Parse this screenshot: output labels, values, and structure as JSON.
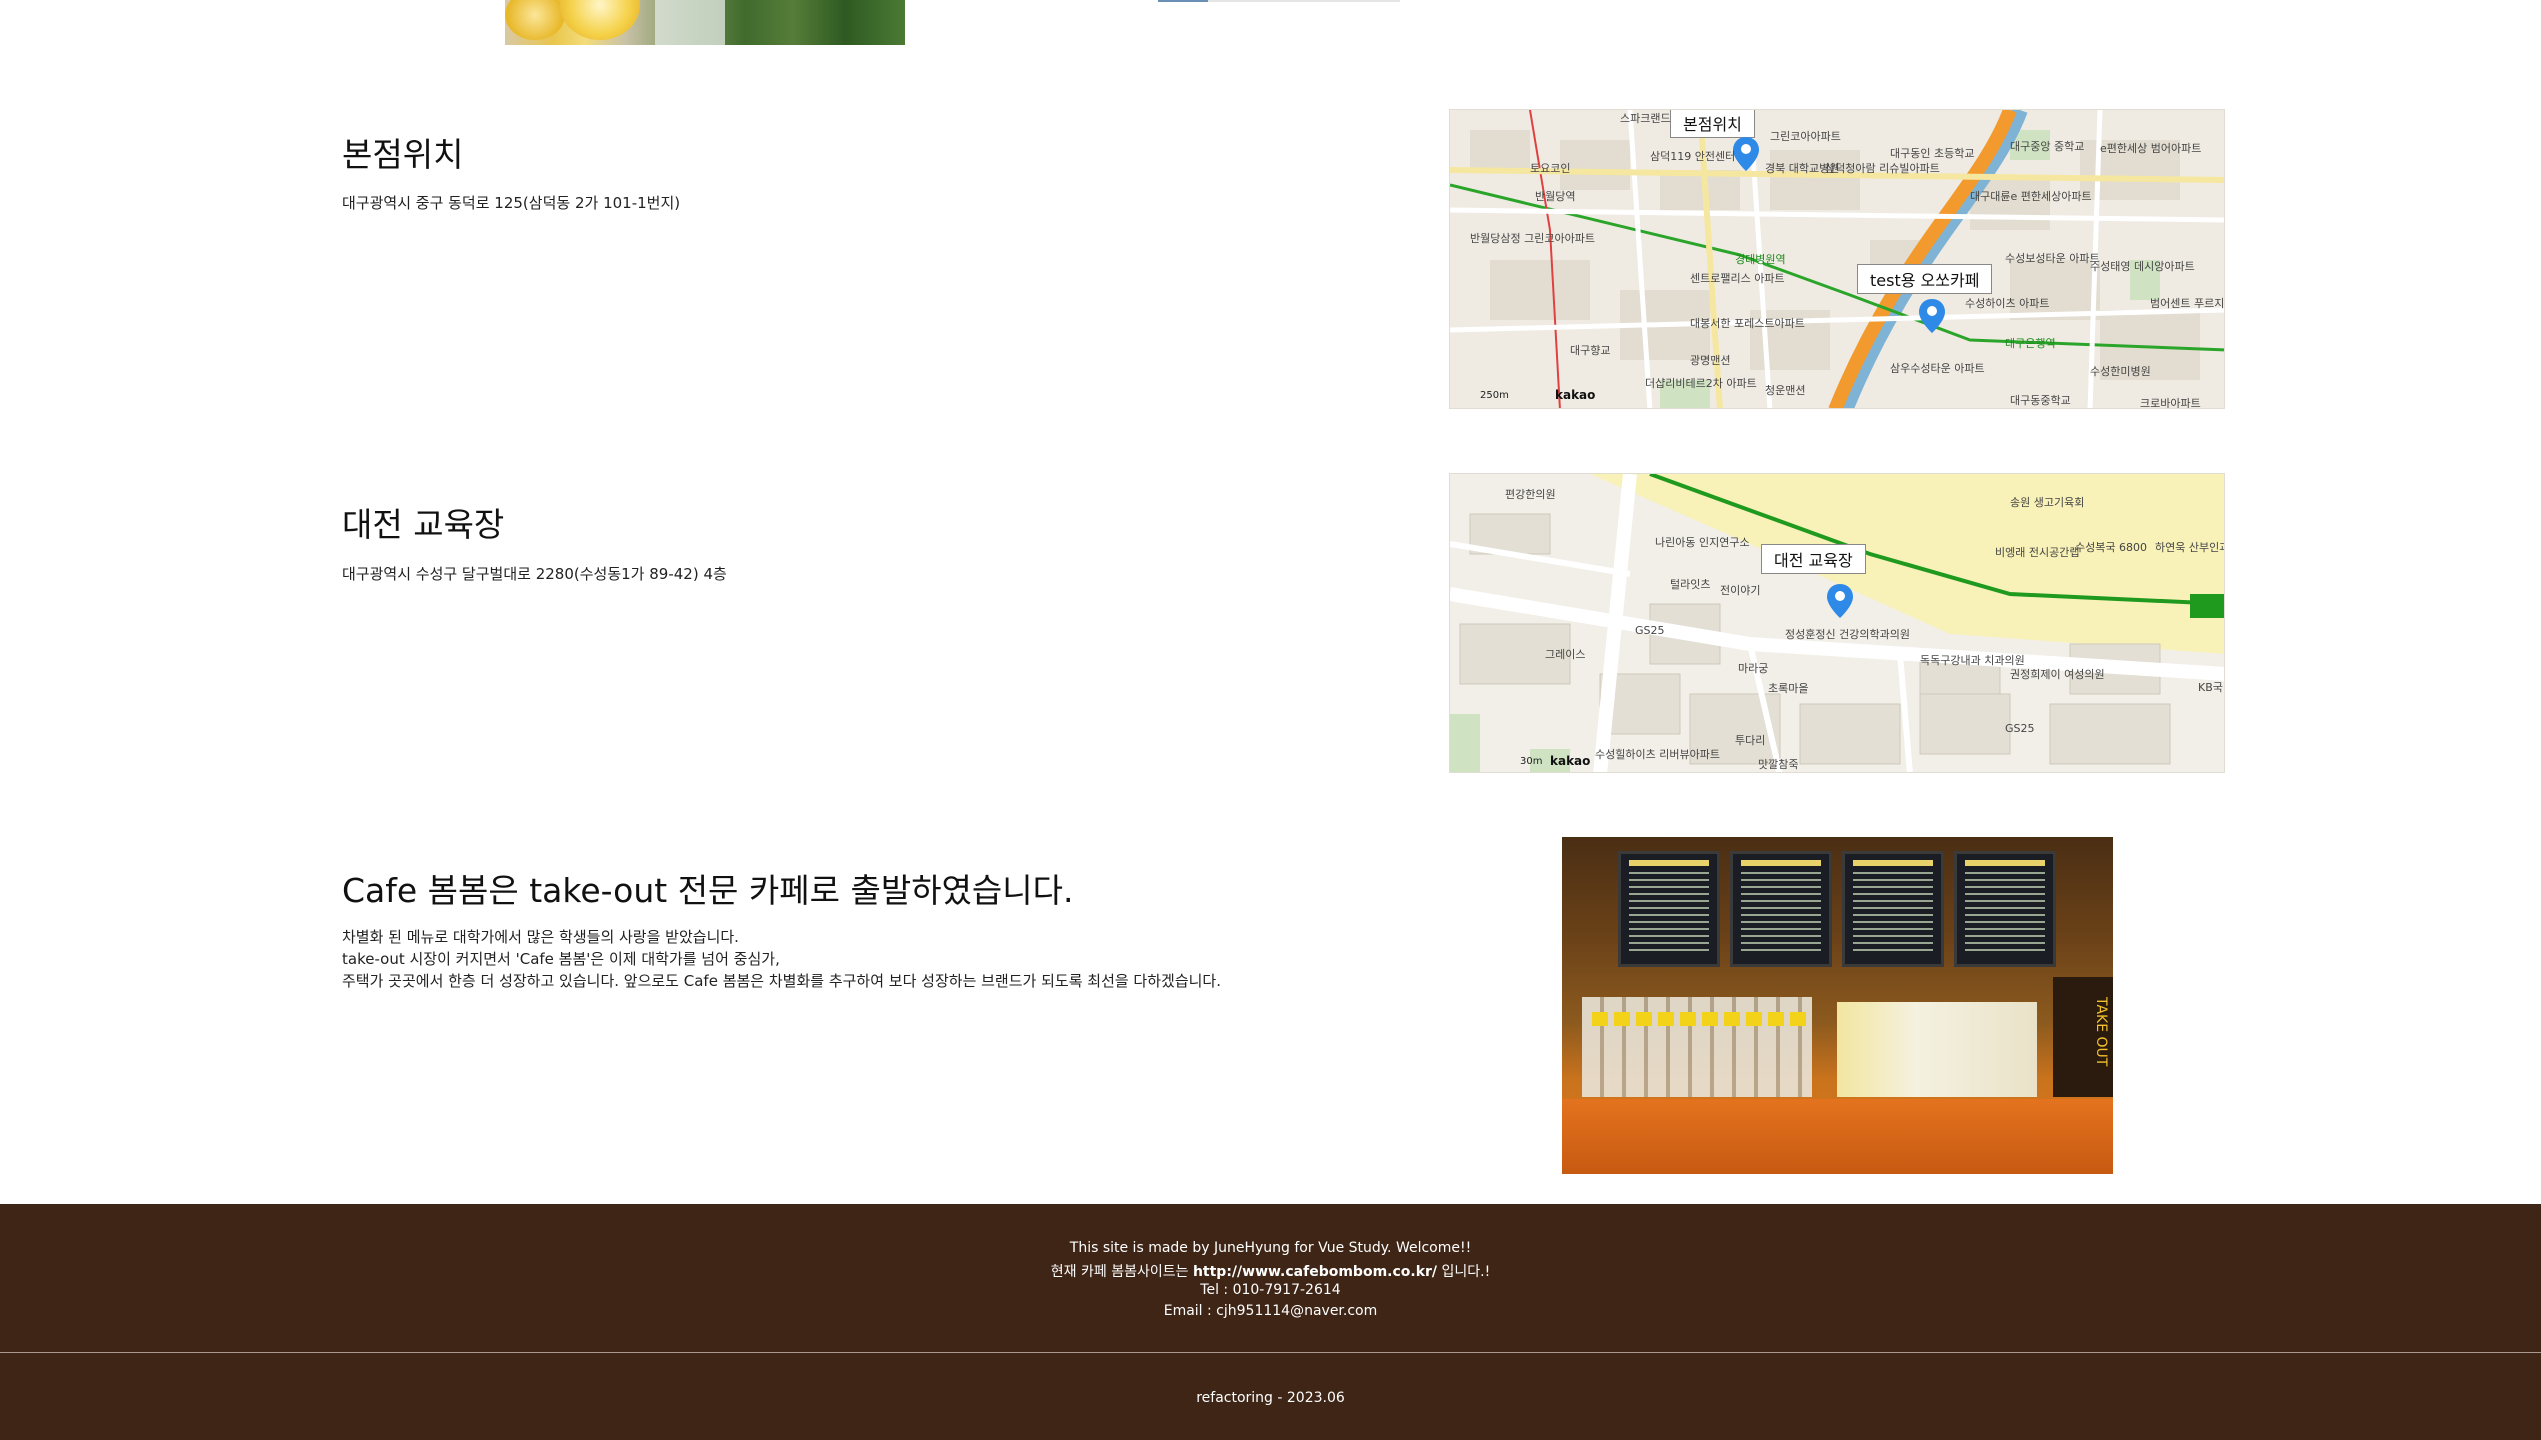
{
  "sections": {
    "hq": {
      "title": "본점위치",
      "address": "대구광역시 중구 동덕로 125(삼덕동 2가 101-1번지)",
      "map": {
        "label_top": "본점위치",
        "label_cafe": "test용 오쏘카페",
        "kakao": "kakao",
        "scale": "250m",
        "places": [
          "스파크랜드",
          "삼덕119 안전센터",
          "토요코인",
          "경북 대학교병원",
          "삼덕청아람 리슈빌아파트",
          "반월당역",
          "반월당삼정 그린코아아파트",
          "센트로팰리스 아파트",
          "대봉서한 포레스트아파트",
          "대구향교",
          "광명맨션",
          "더샵리비테르2차 아파트",
          "청운맨션",
          "경대병원역",
          "대구중앙 중학교",
          "e편한세상 범어아파트",
          "대구대륜e 편한세상아파트",
          "수성보성타운 아파트",
          "수성태영 데시앙아파트",
          "수성하이츠 아파트",
          "삼우수성타운 아파트",
          "대구은행역",
          "수성한미병원",
          "대구동중학교",
          "범어센트 푸르지오아파트",
          "크로바아파트",
          "대구동인 초등학교",
          "그린코아아파트"
        ]
      }
    },
    "daejeon": {
      "title": "대전 교육장",
      "address": "대구광역시 수성구 달구벌대로 2280(수성동1가 89-42) 4층",
      "map": {
        "label": "대전 교육장",
        "kakao": "kakao",
        "scale": "30m",
        "places": [
          "편강한의원",
          "나린아동 인지연구소",
          "털라잇츠",
          "전이야기",
          "GS25",
          "그레이스",
          "정성훈정신 건강의학과의원",
          "마라궁",
          "초록마을",
          "투다리",
          "맛깔참죽",
          "독독구강내과 치과의원",
          "권정희제이 여성의원",
          "비엥래 전시공간랩",
          "수성복국 6800",
          "하연욱 산부인과의원",
          "송원 생고기육회",
          "수성힐하이츠 리버뷰아파트",
          "GS25",
          "KB국"
        ]
      }
    },
    "about": {
      "title": "Cafe 봄봄은 take-out 전문 카페로 출발하였습니다.",
      "lines": [
        "차별화 된 메뉴로 대학가에서 많은 학생들의 사랑을 받았습니다.",
        "take-out 시장이 커지면서 'Cafe 봄봄'은 이제 대학가를 넘어 중심가,",
        "주택가 곳곳에서 한층 더 성장하고 있습니다. 앞으로도 Cafe 봄봄은 차별화를 추구하여 보다 성장하는 브랜드가 되도록 최선을 다하겠습니다."
      ],
      "photo_sign": "TAKE OUT"
    }
  },
  "footer": {
    "line1": "This site is made by JuneHyung for Vue Study. Welcome!!",
    "line2_prefix": "현재 카페 봄봄사이트는 ",
    "line2_link": "http://www.cafebombom.co.kr/",
    "line2_suffix": " 입니다.!",
    "tel": "Tel : 010-7917-2614",
    "email": "Email : cjh951114@naver.com",
    "copyright": "refactoring - 2023.06"
  },
  "colors": {
    "footer_bg": "#3e2516",
    "map_road_green": "#2aa52a",
    "map_road_orange": "#f39a2e",
    "pin_blue": "#2e8ae6"
  },
  "icons": [
    "map-pin-icon"
  ]
}
